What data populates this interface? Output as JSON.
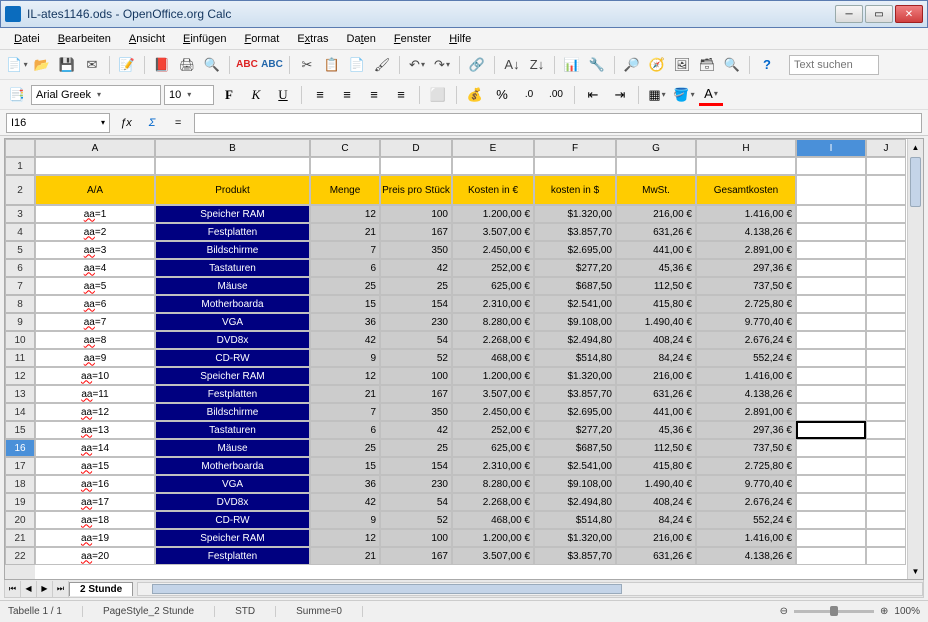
{
  "title": "IL-ates1146.ods - OpenOffice.org Calc",
  "menu": {
    "datei": "Datei",
    "bearbeiten": "Bearbeiten",
    "ansicht": "Ansicht",
    "einfuegen": "Einfügen",
    "format": "Format",
    "extras": "Extras",
    "daten": "Daten",
    "fenster": "Fenster",
    "hilfe": "Hilfe"
  },
  "font": {
    "name": "Arial Greek",
    "size": "10"
  },
  "nameBox": "I16",
  "search_placeholder": "Text suchen",
  "formula": "",
  "cols": [
    "A",
    "B",
    "C",
    "D",
    "E",
    "F",
    "G",
    "H",
    "I",
    "J"
  ],
  "headers": {
    "a": "A/A",
    "b": "Produkt",
    "c": "Menge",
    "d": "Preis pro Stück",
    "e": "Kosten in €",
    "f": "kosten in $",
    "g": "MwSt.",
    "h": "Gesamtkosten"
  },
  "rows": [
    {
      "n": 3,
      "a": "aa=1",
      "b": "Speicher RAM",
      "c": "12",
      "d": "100",
      "e": "1.200,00 €",
      "f": "$1.320,00",
      "g": "216,00 €",
      "h": "1.416,00 €"
    },
    {
      "n": 4,
      "a": "aa=2",
      "b": "Festplatten",
      "c": "21",
      "d": "167",
      "e": "3.507,00 €",
      "f": "$3.857,70",
      "g": "631,26 €",
      "h": "4.138,26 €"
    },
    {
      "n": 5,
      "a": "aa=3",
      "b": "Bildschirme",
      "c": "7",
      "d": "350",
      "e": "2.450,00 €",
      "f": "$2.695,00",
      "g": "441,00 €",
      "h": "2.891,00 €"
    },
    {
      "n": 6,
      "a": "aa=4",
      "b": "Tastaturen",
      "c": "6",
      "d": "42",
      "e": "252,00 €",
      "f": "$277,20",
      "g": "45,36 €",
      "h": "297,36 €"
    },
    {
      "n": 7,
      "a": "aa=5",
      "b": "Mäuse",
      "c": "25",
      "d": "25",
      "e": "625,00 €",
      "f": "$687,50",
      "g": "112,50 €",
      "h": "737,50 €"
    },
    {
      "n": 8,
      "a": "aa=6",
      "b": "Motherboarda",
      "c": "15",
      "d": "154",
      "e": "2.310,00 €",
      "f": "$2.541,00",
      "g": "415,80 €",
      "h": "2.725,80 €"
    },
    {
      "n": 9,
      "a": "aa=7",
      "b": "VGA",
      "c": "36",
      "d": "230",
      "e": "8.280,00 €",
      "f": "$9.108,00",
      "g": "1.490,40 €",
      "h": "9.770,40 €"
    },
    {
      "n": 10,
      "a": "aa=8",
      "b": "DVD8x",
      "c": "42",
      "d": "54",
      "e": "2.268,00 €",
      "f": "$2.494,80",
      "g": "408,24 €",
      "h": "2.676,24 €"
    },
    {
      "n": 11,
      "a": "aa=9",
      "b": "CD-RW",
      "c": "9",
      "d": "52",
      "e": "468,00 €",
      "f": "$514,80",
      "g": "84,24 €",
      "h": "552,24 €"
    },
    {
      "n": 12,
      "a": "aa=10",
      "b": "Speicher RAM",
      "c": "12",
      "d": "100",
      "e": "1.200,00 €",
      "f": "$1.320,00",
      "g": "216,00 €",
      "h": "1.416,00 €"
    },
    {
      "n": 13,
      "a": "aa=11",
      "b": "Festplatten",
      "c": "21",
      "d": "167",
      "e": "3.507,00 €",
      "f": "$3.857,70",
      "g": "631,26 €",
      "h": "4.138,26 €"
    },
    {
      "n": 14,
      "a": "aa=12",
      "b": "Bildschirme",
      "c": "7",
      "d": "350",
      "e": "2.450,00 €",
      "f": "$2.695,00",
      "g": "441,00 €",
      "h": "2.891,00 €"
    },
    {
      "n": 15,
      "a": "aa=13",
      "b": "Tastaturen",
      "c": "6",
      "d": "42",
      "e": "252,00 €",
      "f": "$277,20",
      "g": "45,36 €",
      "h": "297,36 €"
    },
    {
      "n": 16,
      "a": "aa=14",
      "b": "Mäuse",
      "c": "25",
      "d": "25",
      "e": "625,00 €",
      "f": "$687,50",
      "g": "112,50 €",
      "h": "737,50 €"
    },
    {
      "n": 17,
      "a": "aa=15",
      "b": "Motherboarda",
      "c": "15",
      "d": "154",
      "e": "2.310,00 €",
      "f": "$2.541,00",
      "g": "415,80 €",
      "h": "2.725,80 €"
    },
    {
      "n": 18,
      "a": "aa=16",
      "b": "VGA",
      "c": "36",
      "d": "230",
      "e": "8.280,00 €",
      "f": "$9.108,00",
      "g": "1.490,40 €",
      "h": "9.770,40 €"
    },
    {
      "n": 19,
      "a": "aa=17",
      "b": "DVD8x",
      "c": "42",
      "d": "54",
      "e": "2.268,00 €",
      "f": "$2.494,80",
      "g": "408,24 €",
      "h": "2.676,24 €"
    },
    {
      "n": 20,
      "a": "aa=18",
      "b": "CD-RW",
      "c": "9",
      "d": "52",
      "e": "468,00 €",
      "f": "$514,80",
      "g": "84,24 €",
      "h": "552,24 €"
    },
    {
      "n": 21,
      "a": "aa=19",
      "b": "Speicher RAM",
      "c": "12",
      "d": "100",
      "e": "1.200,00 €",
      "f": "$1.320,00",
      "g": "216,00 €",
      "h": "1.416,00 €"
    },
    {
      "n": 22,
      "a": "aa=20",
      "b": "Festplatten",
      "c": "21",
      "d": "167",
      "e": "3.507,00 €",
      "f": "$3.857,70",
      "g": "631,26 €",
      "h": "4.138,26 €"
    }
  ],
  "sheetTab": "2 Stunde",
  "status": {
    "sheet": "Tabelle 1 / 1",
    "style": "PageStyle_2 Stunde",
    "mode": "STD",
    "sum": "Summe=0",
    "zoom": "100%"
  }
}
